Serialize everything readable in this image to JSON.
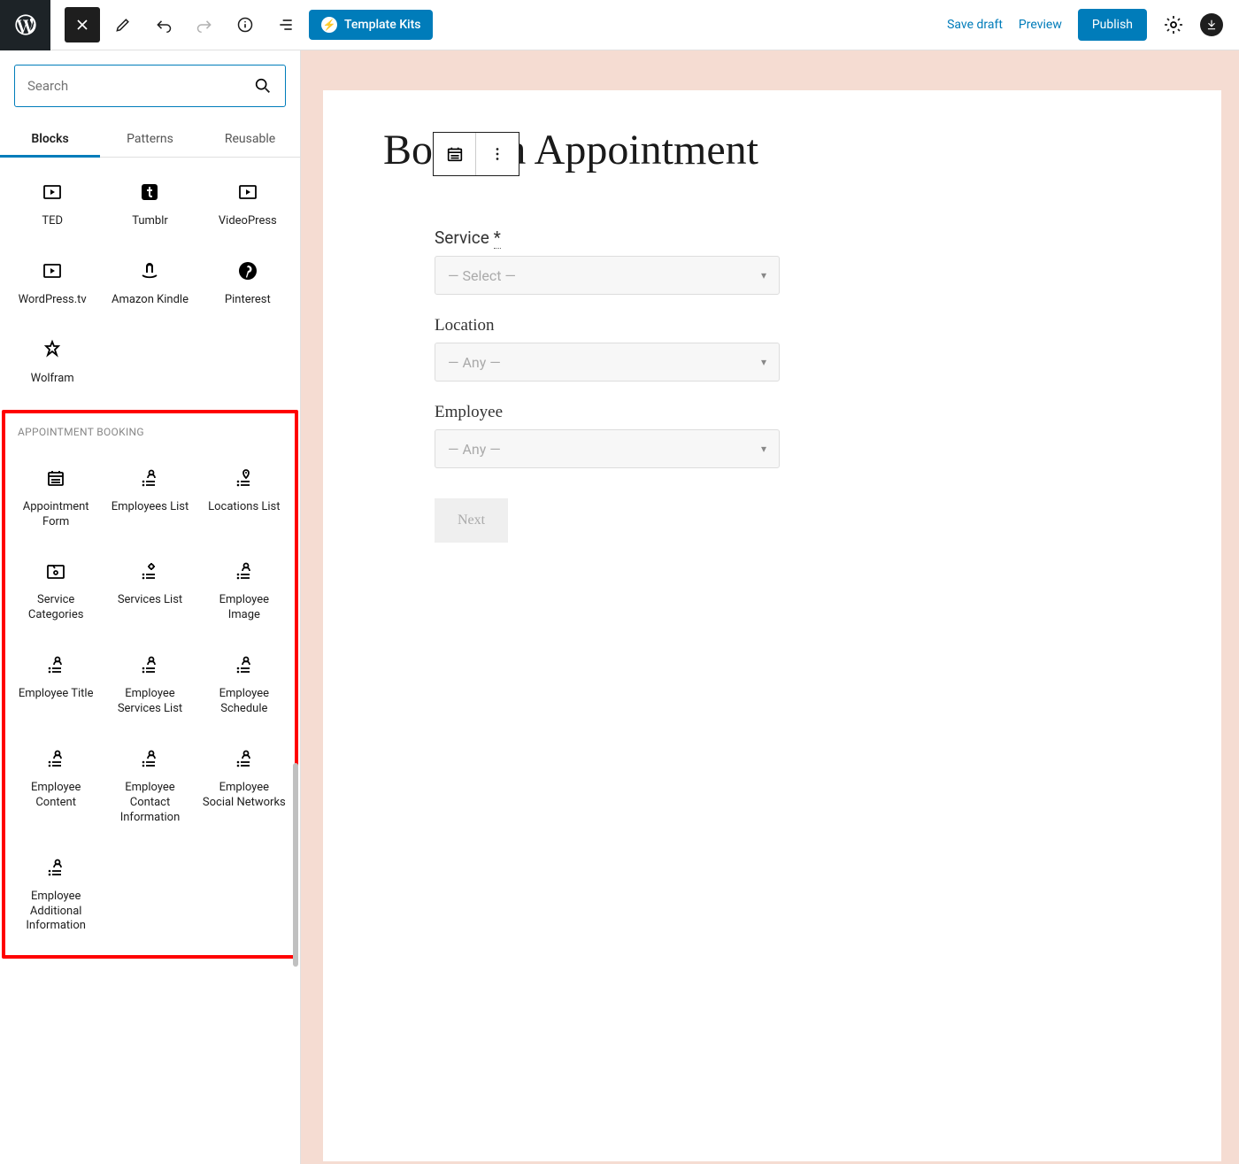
{
  "topbar": {
    "template_kits": "Template Kits",
    "save_draft": "Save draft",
    "preview": "Preview",
    "publish": "Publish"
  },
  "sidebar": {
    "search_placeholder": "Search",
    "tabs": {
      "blocks": "Blocks",
      "patterns": "Patterns",
      "reusable": "Reusable"
    },
    "embed_blocks": [
      {
        "name": "TED",
        "icon": "video"
      },
      {
        "name": "Tumblr",
        "icon": "tumblr"
      },
      {
        "name": "VideoPress",
        "icon": "video"
      },
      {
        "name": "WordPress.tv",
        "icon": "video"
      },
      {
        "name": "Amazon Kindle",
        "icon": "amazon"
      },
      {
        "name": "Pinterest",
        "icon": "pinterest"
      },
      {
        "name": "Wolfram",
        "icon": "wolfram"
      }
    ],
    "appointment_section_title": "Appointment Booking",
    "appointment_blocks": [
      {
        "name": "Appointment Form",
        "icon": "form"
      },
      {
        "name": "Employees List",
        "icon": "person-list"
      },
      {
        "name": "Locations List",
        "icon": "pin-list"
      },
      {
        "name": "Service Categories",
        "icon": "folder-gear"
      },
      {
        "name": "Services List",
        "icon": "gear-list"
      },
      {
        "name": "Employee Image",
        "icon": "person-list"
      },
      {
        "name": "Employee Title",
        "icon": "person-list"
      },
      {
        "name": "Employee Services List",
        "icon": "person-list"
      },
      {
        "name": "Employee Schedule",
        "icon": "person-list"
      },
      {
        "name": "Employee Content",
        "icon": "person-list"
      },
      {
        "name": "Employee Contact Information",
        "icon": "person-list"
      },
      {
        "name": "Employee Social Networks",
        "icon": "person-list"
      },
      {
        "name": "Employee Additional Information",
        "icon": "person-list"
      }
    ]
  },
  "canvas": {
    "title": "Book an Appointment",
    "form": {
      "service": {
        "label": "Service",
        "required_mark": "*",
        "value": "— Select —"
      },
      "location": {
        "label": "Location",
        "value": "— Any —"
      },
      "employee": {
        "label": "Employee",
        "value": "— Any —"
      },
      "next": "Next"
    }
  }
}
